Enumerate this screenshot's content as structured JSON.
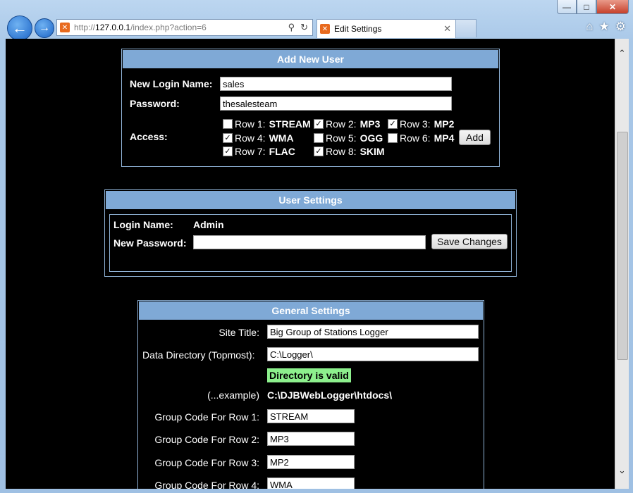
{
  "browser": {
    "url_prefix": "http://",
    "url_host": "127.0.0.1",
    "url_path": "/index.php?action=6",
    "tab_title": "Edit Settings",
    "minimize": "—",
    "maximize": "□",
    "close": "✕"
  },
  "add_user": {
    "title": "Add New User",
    "login_label": "New Login Name:",
    "login_value": "sales",
    "password_label": "Password:",
    "password_value": "thesalesteam",
    "access_label": "Access:",
    "rows": [
      {
        "label": "Row 1:",
        "code": "STREAM",
        "checked": false
      },
      {
        "label": "Row 2:",
        "code": "MP3",
        "checked": true
      },
      {
        "label": "Row 3:",
        "code": "MP2",
        "checked": true
      },
      {
        "label": "Row 4:",
        "code": "WMA",
        "checked": true
      },
      {
        "label": "Row 5:",
        "code": "OGG",
        "checked": false
      },
      {
        "label": "Row 6:",
        "code": "MP4",
        "checked": false
      },
      {
        "label": "Row 7:",
        "code": "FLAC",
        "checked": true
      },
      {
        "label": "Row 8:",
        "code": "SKIM",
        "checked": true
      }
    ],
    "add_button": "Add"
  },
  "user_settings": {
    "title": "User Settings",
    "login_label": "Login Name:",
    "login_value": "Admin",
    "new_password_label": "New Password:",
    "new_password_value": "",
    "save_button": "Save Changes"
  },
  "general_settings": {
    "title": "General Settings",
    "site_title_label": "Site Title:",
    "site_title_value": "Big Group of Stations Logger",
    "data_dir_label": "Data Directory (Topmost):",
    "data_dir_value": "C:\\Logger\\",
    "dir_status": "Directory is valid",
    "example_label": "(...example)",
    "example_value": "C:\\DJBWebLogger\\htdocs\\",
    "group_codes": [
      {
        "label": "Group Code For Row 1:",
        "value": "STREAM"
      },
      {
        "label": "Group Code For Row 2:",
        "value": "MP3"
      },
      {
        "label": "Group Code For Row 3:",
        "value": "MP2"
      },
      {
        "label": "Group Code For Row 4:",
        "value": "WMA"
      }
    ]
  }
}
